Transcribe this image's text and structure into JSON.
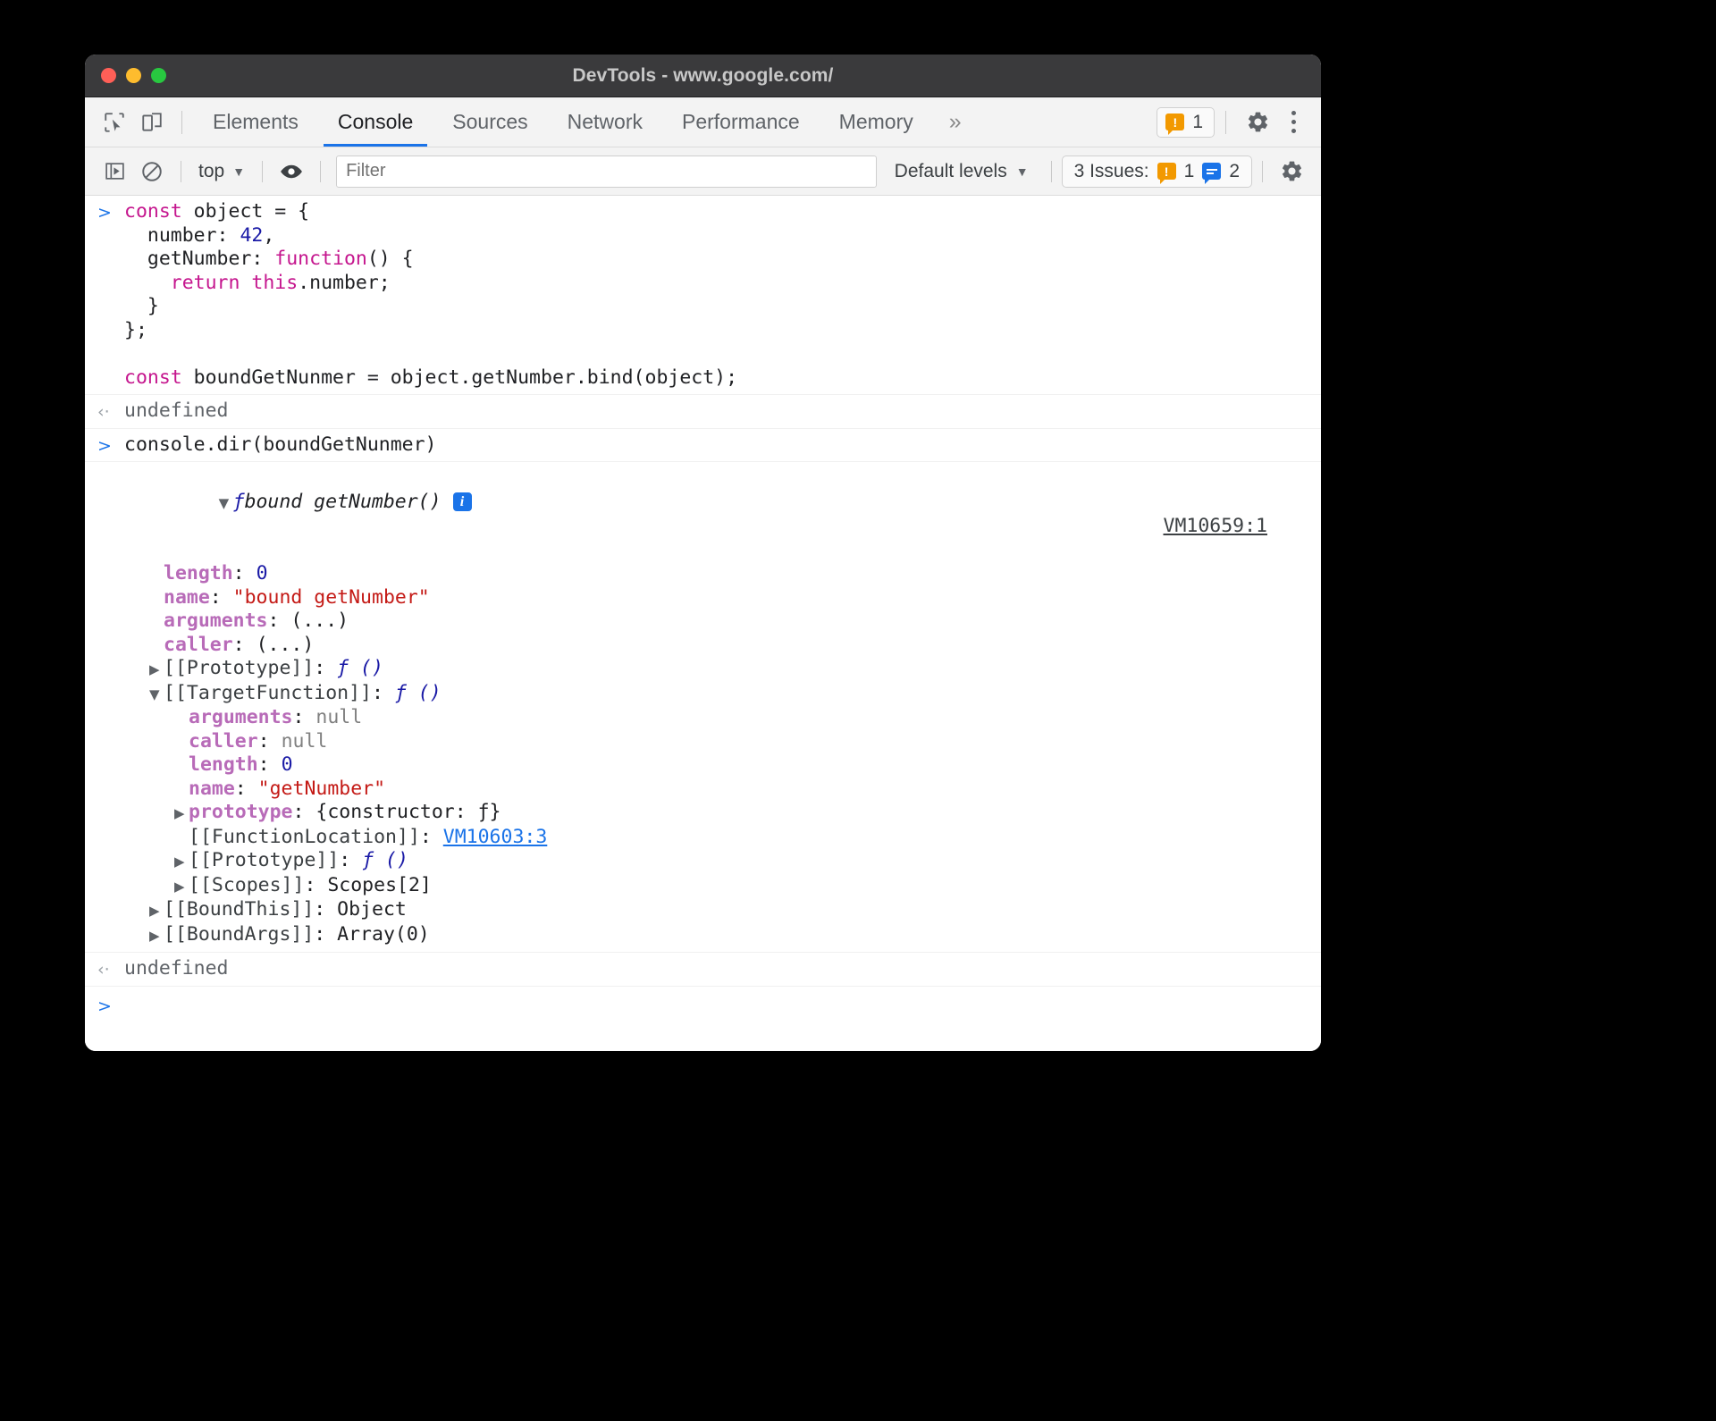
{
  "window": {
    "title": "DevTools - www.google.com/",
    "traffic_lights": [
      "close",
      "minimize",
      "maximize"
    ]
  },
  "tabbar": {
    "icons": [
      "inspect-element-icon",
      "device-toolbar-icon"
    ],
    "tabs": [
      {
        "label": "Elements",
        "active": false
      },
      {
        "label": "Console",
        "active": true
      },
      {
        "label": "Sources",
        "active": false
      },
      {
        "label": "Network",
        "active": false
      },
      {
        "label": "Performance",
        "active": false
      },
      {
        "label": "Memory",
        "active": false
      }
    ],
    "more_tabs": "»",
    "warning_count": "1",
    "settings_icon": "gear-icon",
    "menu_icon": "kebab-menu-icon"
  },
  "filterbar": {
    "sidebar_toggle": "console-sidebar-icon",
    "clear_console": "clear-console-icon",
    "context": "top",
    "context_caret": "▼",
    "eye_icon": "live-expression-icon",
    "filter_placeholder": "Filter",
    "filter_value": "",
    "levels_label": "Default levels",
    "levels_caret": "▼",
    "issues_label": "3 Issues:",
    "issues_warn_count": "1",
    "issues_info_count": "2",
    "settings_icon": "gear-icon"
  },
  "console": {
    "input1": {
      "lines": [
        [
          {
            "t": "const",
            "c": "kw"
          },
          {
            "t": " object = {",
            "c": ""
          }
        ],
        [
          {
            "t": "  number: ",
            "c": ""
          },
          {
            "t": "42",
            "c": "num"
          },
          {
            "t": ",",
            "c": ""
          }
        ],
        [
          {
            "t": "  getNumber: ",
            "c": ""
          },
          {
            "t": "function",
            "c": "kw"
          },
          {
            "t": "() {",
            "c": ""
          }
        ],
        [
          {
            "t": "    ",
            "c": ""
          },
          {
            "t": "return",
            "c": "kw"
          },
          {
            "t": " ",
            "c": ""
          },
          {
            "t": "this",
            "c": "kw"
          },
          {
            "t": ".number;",
            "c": ""
          }
        ],
        [
          {
            "t": "  }",
            "c": ""
          }
        ],
        [
          {
            "t": "};",
            "c": ""
          }
        ],
        [
          {
            "t": "",
            "c": ""
          }
        ],
        [
          {
            "t": "const",
            "c": "kw"
          },
          {
            "t": " boundGetNunmer = object.getNumber.bind(object);",
            "c": ""
          }
        ]
      ]
    },
    "result1": "undefined",
    "input2": "console.dir(boundGetNunmer)",
    "output_header": {
      "triangle": "▼",
      "f_glyph": "ƒ",
      "label": "bound getNumber()",
      "info_badge": "i",
      "vm_link": "VM10659:1"
    },
    "tree": [
      {
        "indent": 1,
        "tri": "",
        "key": "length",
        "keyclass": "prop",
        "sep": ": ",
        "val": "0",
        "valclass": "num"
      },
      {
        "indent": 1,
        "tri": "",
        "key": "name",
        "keyclass": "prop",
        "sep": ": ",
        "val": "\"bound getNumber\"",
        "valclass": "str"
      },
      {
        "indent": 1,
        "tri": "",
        "key": "arguments",
        "keyclass": "prop",
        "sep": ": ",
        "val": "(...)",
        "valclass": ""
      },
      {
        "indent": 1,
        "tri": "",
        "key": "caller",
        "keyclass": "prop",
        "sep": ": ",
        "val": "(...)",
        "valclass": ""
      },
      {
        "indent": 1,
        "tri": "▶",
        "key": "[[Prototype]]",
        "keyclass": "internal",
        "sep": ": ",
        "val": "ƒ ()",
        "valclass": "fnblue"
      },
      {
        "indent": 1,
        "tri": "▼",
        "key": "[[TargetFunction]]",
        "keyclass": "internal",
        "sep": ": ",
        "val": "ƒ ()",
        "valclass": "fnblue"
      },
      {
        "indent": 2,
        "tri": "",
        "key": "arguments",
        "keyclass": "prop",
        "sep": ": ",
        "val": "null",
        "valclass": "nullv"
      },
      {
        "indent": 2,
        "tri": "",
        "key": "caller",
        "keyclass": "prop",
        "sep": ": ",
        "val": "null",
        "valclass": "nullv"
      },
      {
        "indent": 2,
        "tri": "",
        "key": "length",
        "keyclass": "prop",
        "sep": ": ",
        "val": "0",
        "valclass": "num"
      },
      {
        "indent": 2,
        "tri": "",
        "key": "name",
        "keyclass": "prop",
        "sep": ": ",
        "val": "\"getNumber\"",
        "valclass": "str"
      },
      {
        "indent": 2,
        "tri": "▶",
        "key": "prototype",
        "keyclass": "prop",
        "sep": ": ",
        "val": "{constructor: ƒ}",
        "valclass": ""
      },
      {
        "indent": 2,
        "tri": "",
        "key": "[[FunctionLocation]]",
        "keyclass": "internal",
        "sep": ": ",
        "val": "VM10603:3",
        "valclass": "link"
      },
      {
        "indent": 2,
        "tri": "▶",
        "key": "[[Prototype]]",
        "keyclass": "internal",
        "sep": ": ",
        "val": "ƒ ()",
        "valclass": "fnblue"
      },
      {
        "indent": 2,
        "tri": "▶",
        "key": "[[Scopes]]",
        "keyclass": "internal",
        "sep": ": ",
        "val": "Scopes[2]",
        "valclass": ""
      },
      {
        "indent": 1,
        "tri": "▶",
        "key": "[[BoundThis]]",
        "keyclass": "internal",
        "sep": ": ",
        "val": "Object",
        "valclass": ""
      },
      {
        "indent": 1,
        "tri": "▶",
        "key": "[[BoundArgs]]",
        "keyclass": "internal",
        "sep": ": ",
        "val": "Array(0)",
        "valclass": ""
      }
    ],
    "result2": "undefined",
    "prompt_glyph": ">",
    "input_glyph": ">",
    "output_glyph": "‹·"
  },
  "colors": {
    "accent": "#1a73e8",
    "warning": "#f29900",
    "keyword": "#c5168e",
    "string": "#c41a16",
    "number": "#1a1aa6",
    "property": "#b86bb8"
  }
}
